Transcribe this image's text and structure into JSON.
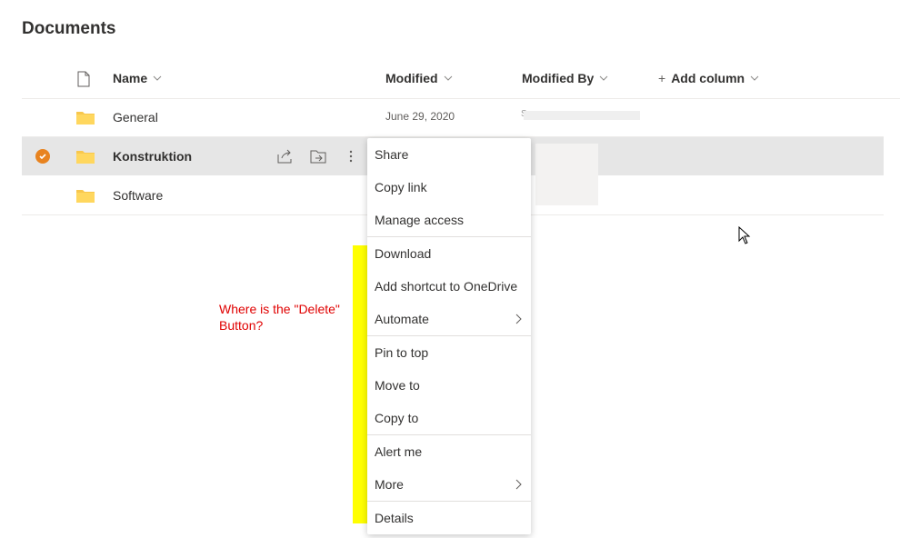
{
  "page": {
    "title": "Documents"
  },
  "columns": {
    "name": "Name",
    "modified": "Modified",
    "modified_by": "Modified By",
    "add_column": "Add column"
  },
  "rows": [
    {
      "name": "General",
      "modified": "June 29, 2020",
      "modified_by": "S",
      "selected": false
    },
    {
      "name": "Konstruktion",
      "modified": "",
      "modified_by": "",
      "selected": true
    },
    {
      "name": "Software",
      "modified": "",
      "modified_by": "",
      "selected": false
    }
  ],
  "context_menu": {
    "groups": [
      [
        "Share",
        "Copy link",
        "Manage access"
      ],
      [
        "Download",
        "Add shortcut to OneDrive",
        "Automate"
      ],
      [
        "Pin to top",
        "Move to",
        "Copy to"
      ],
      [
        "Alert me",
        "More"
      ],
      [
        "Details"
      ]
    ]
  },
  "annotation": {
    "text_line1": "Where is the \"Delete\"",
    "text_line2": "Button?"
  },
  "colors": {
    "accent": "#e8831f",
    "folder": "#f8c74d",
    "highlight": "#ffff00",
    "annotation": "#e00000",
    "selected_row": "#e6e6e6"
  },
  "icons": {
    "file": "file-icon",
    "folder": "folder-icon",
    "share": "share-icon",
    "move": "move-folder-icon",
    "more": "more-vertical-icon",
    "chevron": "chevron-down-icon",
    "submenu": "chevron-right-icon",
    "check": "checkmark-icon",
    "cursor": "mouse-pointer-icon"
  }
}
